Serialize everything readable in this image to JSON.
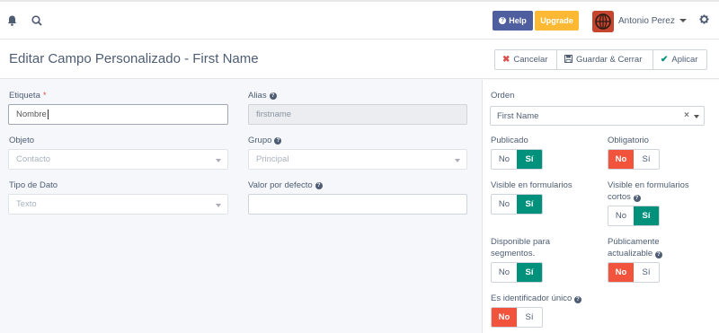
{
  "topbar": {
    "help_label": "Help",
    "upgrade_label": "Upgrade",
    "user_name": "Antonio Perez"
  },
  "header": {
    "title": "Editar Campo Personalizado - First Name",
    "cancel_label": "Cancelar",
    "save_close_label": "Guardar & Cerrar",
    "apply_label": "Aplicar"
  },
  "form": {
    "etiqueta": {
      "label": "Etiqueta",
      "required_mark": "*",
      "value": "Nombre"
    },
    "alias": {
      "label": "Alias",
      "value": "firstname"
    },
    "objeto": {
      "label": "Objeto",
      "value": "Contacto"
    },
    "grupo": {
      "label": "Grupo",
      "value": "Principal"
    },
    "tipo": {
      "label": "Tipo de Dato",
      "value": "Texto"
    },
    "valor": {
      "label": "Valor por defecto",
      "value": ""
    }
  },
  "options": {
    "orden": {
      "label": "Orden",
      "value": "First Name",
      "clear": "×"
    },
    "no_label": "No",
    "si_label": "Sí",
    "publicado": {
      "label": "Publicado",
      "value": "Sí"
    },
    "obligatorio": {
      "label": "Obligatorio",
      "value": "No"
    },
    "visible_form": {
      "label": "Visible en formularios",
      "value": "Sí"
    },
    "visible_cortos": {
      "label": "Visible en formularios cortos",
      "value": "Sí"
    },
    "disponible": {
      "label": "Disponible para segmentos.",
      "value": "Sí"
    },
    "publico": {
      "label": "Públicamente actualizable",
      "value": "No"
    },
    "identificador": {
      "label": "Es identificador único",
      "value": "No"
    }
  },
  "colors": {
    "active_si": "#00917c",
    "active_no": "#f2533c",
    "help": "#4e5e9e",
    "upgrade": "#fdb933"
  }
}
